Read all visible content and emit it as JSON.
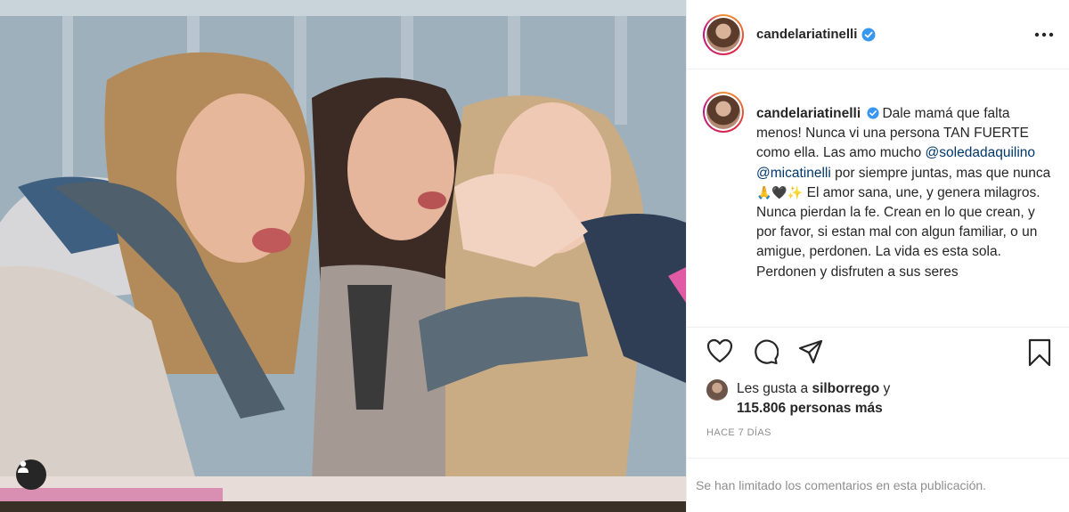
{
  "post": {
    "photo_alt": "",
    "tag_icon": "user-tag-icon"
  },
  "header": {
    "username": "candelariatinelli",
    "verified_icon": "verified-badge-icon",
    "more_icon": "more-options-icon"
  },
  "caption": {
    "username": "candelariatinelli",
    "text_1": "Dale mamá que falta menos! Nunca vi una persona TAN FUERTE como ella. Las amo mucho ",
    "mention_1": "@soledadaquilino",
    "mention_2": "@micatinelli",
    "text_2": " por siempre juntas, mas que nunca ",
    "emojis": "🙏🖤✨",
    "text_3": " El amor sana, une, y genera milagros. Nunca pierdan la fe. Crean en lo que crean, y por favor, si estan mal con algun familiar, o un amigue, perdonen. La vida es esta sola. Perdonen y disfruten a sus seres"
  },
  "actions": {
    "like_icon": "heart-icon",
    "comment_icon": "comment-icon",
    "share_icon": "share-icon",
    "save_icon": "bookmark-icon"
  },
  "likes": {
    "prefix": "Les gusta a ",
    "user": "silborrego",
    "connector": " y",
    "count": "115.806 personas más"
  },
  "date": "HACE 7 DÍAS",
  "comments_notice": "Se han limitado los comentarios en esta publicación."
}
